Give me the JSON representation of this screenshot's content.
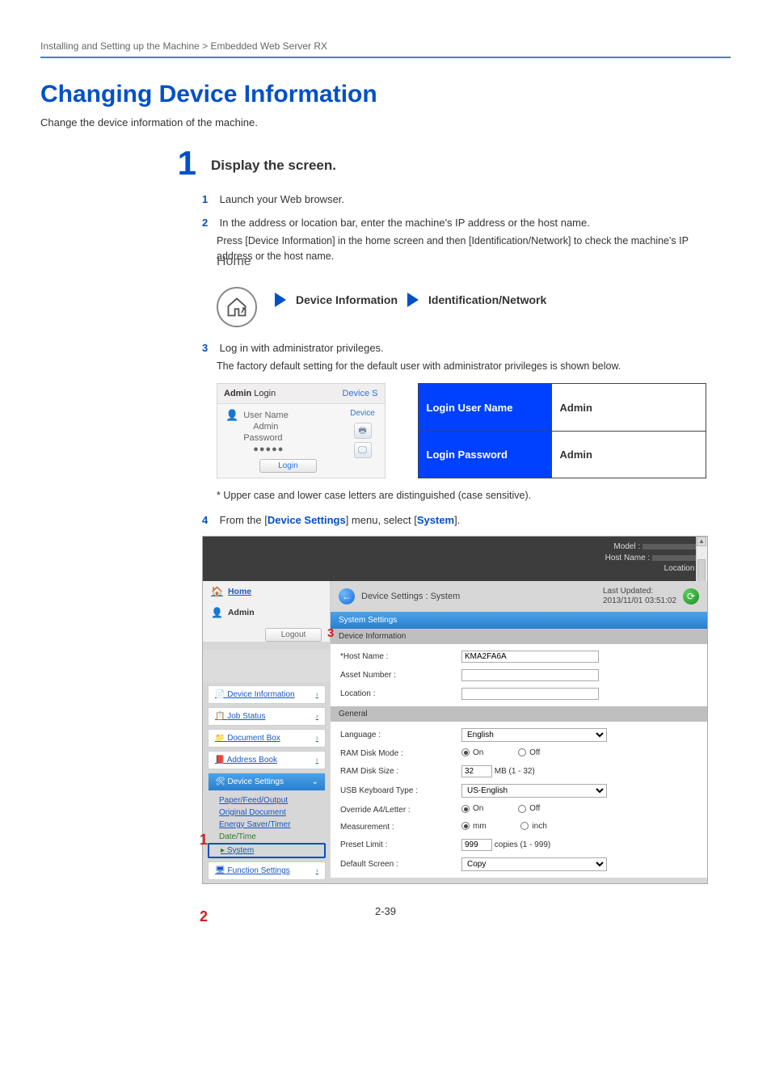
{
  "breadcrumb": "Installing and Setting up the Machine > Embedded Web Server RX",
  "h1": "Changing Device Information",
  "intro": "Change the device information of the machine.",
  "step1": {
    "num": "1",
    "title": "Display the screen.",
    "s1": {
      "num": "1",
      "text": "Launch your Web browser."
    },
    "s2": {
      "num": "2",
      "text": "In the address or location bar, enter the machine's IP address or the host name.",
      "note": "Press [Device Information] in the home screen and then [Identification/Network] to check the machine's IP address or the host name."
    },
    "home": {
      "label": "Home",
      "devinfo": "Device Information",
      "ident": "Identification/Network"
    },
    "s3": {
      "num": "3",
      "text": "Log in with administrator privileges.",
      "note": "The factory default setting for the default user with administrator privileges is shown below."
    },
    "login_panel": {
      "header": "Admin Login",
      "device_s": "Device S",
      "device": "Device",
      "username_label": "User Name",
      "username_val": "Admin",
      "password_label": "Password",
      "password_val": "●●●●●",
      "login_btn": "Login"
    },
    "cred": {
      "user_label": "Login User Name",
      "user_val": "Admin",
      "pass_label": "Login Password",
      "pass_val": "Admin"
    },
    "case_note": "* Upper case and lower case letters are distinguished (case sensitive).",
    "s4": {
      "num": "4",
      "prefix": "From the [",
      "link1": "Device Settings",
      "mid": "] menu, select [",
      "link2": "System",
      "suffix": "]."
    }
  },
  "scr": {
    "black": {
      "model": "Model :",
      "host": "Host Name :",
      "loc": "Location :"
    },
    "titlebar": {
      "title": "Device Settings : System",
      "last_lbl": "Last Updated:",
      "last_val": "2013/11/01 03:51:02"
    },
    "side": {
      "home": "Home",
      "admin": "Admin",
      "logout": "Logout",
      "menu": {
        "devinfo": "Device Information",
        "job": "Job Status",
        "docbox": "Document Box",
        "addr": "Address Book",
        "devset": "Device Settings",
        "func": "Function Settings"
      },
      "sub": {
        "paper": "Paper/Feed/Output",
        "orig": "Original Document",
        "energy": "Energy Saver/Timer",
        "dt": "Date/Time",
        "sys": "System"
      }
    },
    "sys_head": "System Settings",
    "sec_devinfo": "Device Information",
    "sec_general": "General",
    "callouts": {
      "c1": "1",
      "c2": "2",
      "c3": "3"
    },
    "fields": {
      "hostname_k": "*Host Name :",
      "hostname_v": "KMA2FA6A",
      "asset_k": "Asset Number :",
      "location_k": "Location :",
      "lang_k": "Language :",
      "lang_v": "English",
      "rammode_k": "RAM Disk Mode :",
      "on": "On",
      "off": "Off",
      "ramsize_k": "RAM Disk Size :",
      "ramsize_v": "32",
      "ramsize_unit": "MB (1 - 32)",
      "usbkb_k": "USB Keyboard Type :",
      "usbkb_v": "US-English",
      "override_k": "Override A4/Letter :",
      "meas_k": "Measurement :",
      "mm": "mm",
      "inch": "inch",
      "preset_k": "Preset Limit :",
      "preset_v": "999",
      "preset_unit": "copies (1 - 999)",
      "defscr_k": "Default Screen :",
      "defscr_v": "Copy"
    }
  },
  "page_num": "2-39"
}
